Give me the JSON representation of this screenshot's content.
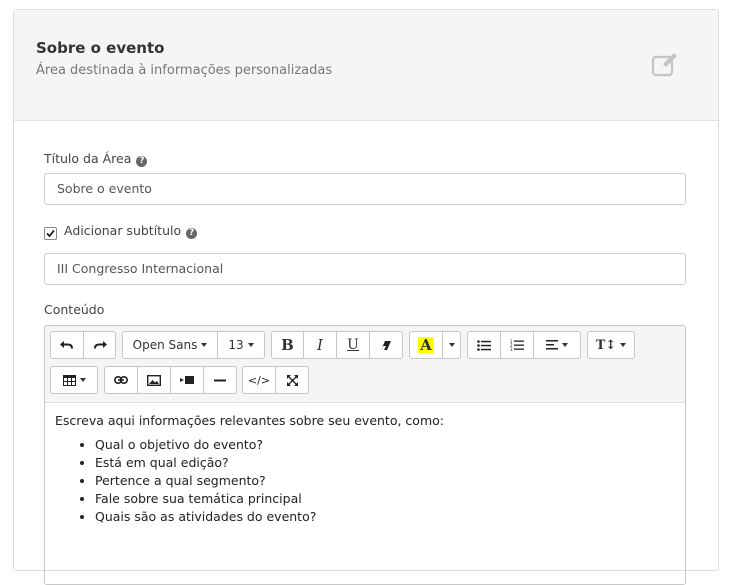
{
  "header": {
    "title": "Sobre o evento",
    "subtitle": "Área destinada à informações personalizadas",
    "edit_icon": "edit-square-icon"
  },
  "title_field": {
    "label": "Título da Área",
    "value": "Sobre o evento"
  },
  "subtitle_toggle": {
    "label": "Adicionar subtítulo",
    "checked": true
  },
  "subtitle_field": {
    "value": "III Congresso Internacional"
  },
  "content_field": {
    "label": "Conteúdo"
  },
  "toolbar": {
    "font_family": "Open Sans",
    "font_size": "13",
    "bold": "B",
    "italic": "I",
    "underline": "U",
    "color": "A",
    "text_size": "T↕",
    "code": "</>",
    "highlight_color": "#ffff00"
  },
  "editor": {
    "intro": "Escreva aqui informações relevantes sobre seu evento, como:",
    "items": [
      "Qual o objetivo do evento?",
      "Está em qual edição?",
      "Pertence a qual segmento?",
      "Fale sobre sua temática principal",
      "Quais são as atividades do evento?"
    ]
  }
}
